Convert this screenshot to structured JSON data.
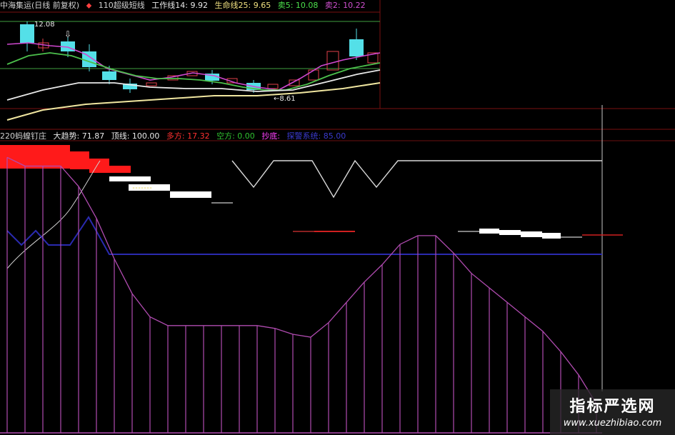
{
  "upper_panel": {
    "header": {
      "stock_name": "中海集运(日线 前复权)",
      "indicator_name": "110超级短线",
      "work_line": "工作线14: 9.92",
      "life_line": "生命线25: 9.65",
      "sell5": "卖5: 10.08",
      "sell2": "卖2: 10.22"
    },
    "annotations": {
      "high_label": "12.08",
      "low_label": "8.61"
    },
    "colors": {
      "up": "#e0404a",
      "down": "#54e0e8",
      "ma_green": "#4cc04c",
      "ma_white": "#e8e8e8",
      "ma_yellow": "#f0e6a0",
      "ma_magenta": "#d048d0"
    }
  },
  "lower_panel": {
    "header": {
      "title": "220蚂蝗钉庄",
      "trend": "大趋势: 71.87",
      "top": "顶线: 100.00",
      "bull": "多方: 17.32",
      "bear": "空方: 0.00",
      "bottom_copy": "抄底:",
      "system": "探警系统: 85.00"
    },
    "colors": {
      "bull": "#ff1a1a",
      "bear": "#ffffff",
      "trend": "#c050c0",
      "blue": "#2a2ab0"
    }
  },
  "watermark": {
    "title": "指标严选网",
    "url": "www.xuezhibiao.com"
  },
  "chart_data": [
    {
      "type": "candlestick",
      "title": "",
      "annotations": [
        "12.08",
        "8.61"
      ],
      "moving_averages": [
        "工作线14",
        "生命线25"
      ]
    },
    {
      "type": "area",
      "title": "",
      "series": [
        {
          "values": [
            95,
            92,
            92,
            92,
            85,
            74,
            60,
            48,
            40,
            37,
            37,
            37,
            37,
            37,
            37,
            36,
            34,
            33,
            38,
            45,
            52,
            58,
            65,
            68,
            68,
            62,
            55,
            50,
            45,
            40,
            35,
            28,
            20,
            10
          ]
        }
      ]
    }
  ]
}
